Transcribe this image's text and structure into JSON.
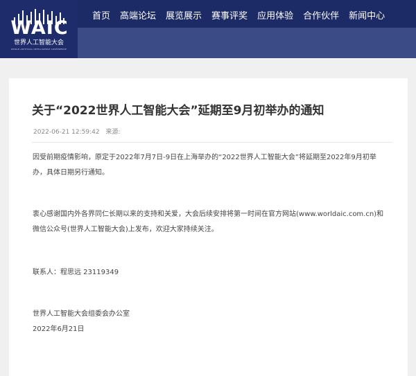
{
  "logo": {
    "word": "WAIC",
    "cn": "世界人工智能大会",
    "en": "WORLD ARTIFICIAL INTELLIGENCE CONFERENCE"
  },
  "nav": {
    "items": [
      {
        "label": "首页"
      },
      {
        "label": "高端论坛"
      },
      {
        "label": "展览展示"
      },
      {
        "label": "赛事评奖"
      },
      {
        "label": "应用体验"
      },
      {
        "label": "合作伙伴"
      },
      {
        "label": "新闻中心"
      }
    ]
  },
  "article": {
    "title": "关于“2022世界人工智能大会”延期至9月初举办的通知",
    "datetime": "2022-06-21 12:59:42",
    "source_label": "来源:",
    "paragraph1": "因受前期疫情影响，原定于2022年7月7日-9日在上海举办的“2022世界人工智能大会”将延期至2022年9月初举办，具体日期另行通知。",
    "paragraph2": "衷心感谢国内外各界同仁长期以来的支持和关爱，大会后续安排将第一时间在官方网站(www.worldaic.com.cn)和微信公众号(世界人工智能大会)上发布，欢迎大家持续关注。",
    "contact": "联系人：程思远 23119349",
    "office": "世界人工智能大会组委会办公室",
    "date": "2022年6月21日"
  },
  "colors": {
    "header_dark": "#1c2a66",
    "header_band": "#3a4b86",
    "background": "#f0f0f0"
  }
}
